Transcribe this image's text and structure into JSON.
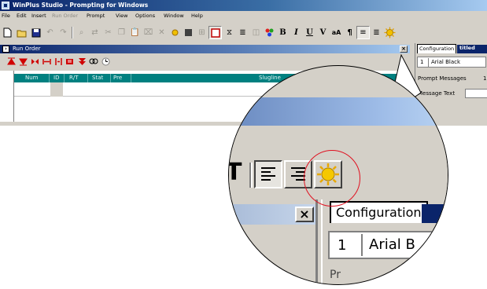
{
  "window": {
    "title": "WinPlus Studio - Prompting for Windows"
  },
  "menu": [
    {
      "label": "File",
      "enabled": true
    },
    {
      "label": "Edit",
      "enabled": true
    },
    {
      "label": "Insert",
      "enabled": true
    },
    {
      "label": "Run Order",
      "enabled": false
    },
    {
      "label": "Prompt",
      "enabled": true
    },
    {
      "label": "View",
      "enabled": true
    },
    {
      "label": "Options",
      "enabled": true
    },
    {
      "label": "Window",
      "enabled": true
    },
    {
      "label": "Help",
      "enabled": true
    }
  ],
  "toolbar": {
    "bold_label": "B",
    "italic_label": "I",
    "underline_label": "U",
    "v_label": "V",
    "case_label": "aA",
    "pilcrow_label": "¶",
    "icons": [
      "new-icon",
      "open-icon",
      "save-icon",
      "undo-icon",
      "redo-icon",
      "find-icon",
      "replace-icon",
      "cut-icon",
      "copy-icon",
      "paste-icon",
      "delete-icon",
      "no-icon",
      "sun-icon",
      "block-icon",
      "insert-icon",
      "caption-icon",
      "cue-icon",
      "justify-icon",
      "color-icon",
      "bold-icon",
      "italic-icon",
      "underline-icon",
      "v-icon",
      "case-icon",
      "pilcrow-icon",
      "align-left-icon",
      "align-right-icon",
      "configuration-icon"
    ]
  },
  "run_order": {
    "title": "Run Order",
    "close_label": "×",
    "columns": [
      "Num",
      "ID",
      "R/T",
      "Stat",
      "Pre",
      "Slugline"
    ]
  },
  "config_panel": {
    "tab_label": "Configuration",
    "right_tab_label": "titled",
    "row_number": "1",
    "font_name": "Arial Black",
    "prompt_messages_label": "Prompt Messages",
    "prompt_messages_value": "1",
    "message_text_label": "Message Text"
  },
  "callout": {
    "tab_label": "Configuration",
    "row_number": "1",
    "font_name": "Arial B",
    "close_label": "×",
    "bottom_text": "Pr"
  },
  "colors": {
    "title_bar": "#0a246a",
    "column_header": "#008080",
    "highlight_ring": "#e01020",
    "chrome": "#d4d0c8"
  }
}
